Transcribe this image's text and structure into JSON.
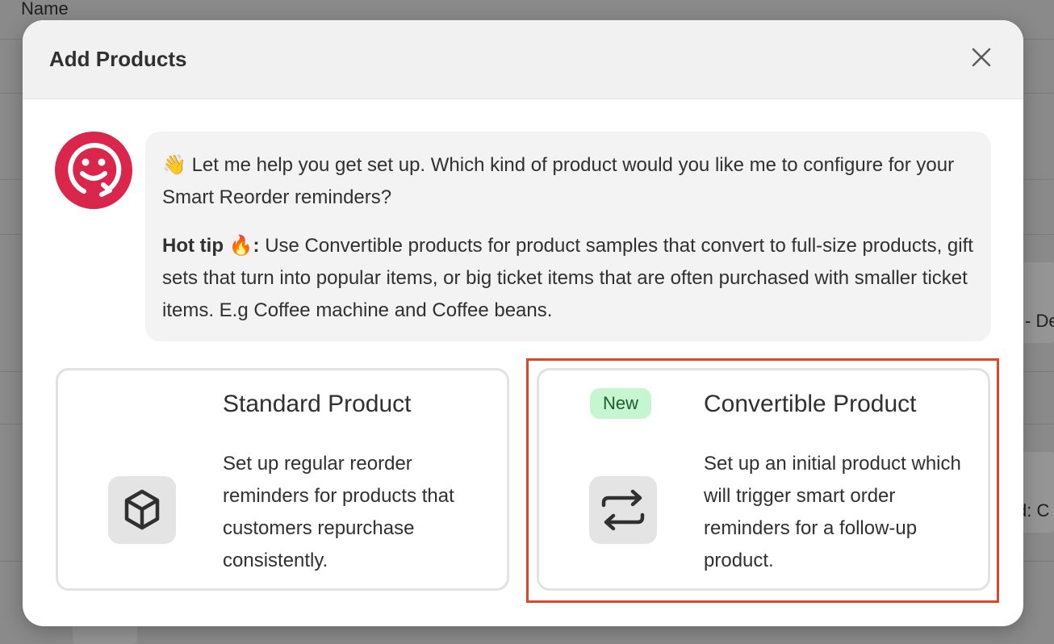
{
  "background": {
    "column_header": "Name",
    "partial_texts": [
      "- De",
      "d: C"
    ]
  },
  "modal": {
    "title": "Add Products",
    "close_icon": "close-icon",
    "assistant": {
      "avatar_icon": "smiley-reorder-icon",
      "avatar_color": "#d9264a",
      "intro_emoji": "👋",
      "intro_text": "Let me help you get set up. Which kind of product would you like me to configure for your Smart Reorder reminders?",
      "hot_tip_label": "Hot tip 🔥:",
      "hot_tip_text": "Use Convertible products for product samples that convert to full-size products, gift sets that turn into popular items, or big ticket items that are often purchased with smaller ticket items. E.g Coffee machine and Coffee beans."
    },
    "options": [
      {
        "id": "standard",
        "title": "Standard Product",
        "description": "Set up regular reorder reminders for products that customers repurchase consistently.",
        "icon": "cube-icon",
        "badge": null
      },
      {
        "id": "convertible",
        "title": "Convertible Product",
        "description": "Set up an initial product which will trigger smart order reminders for a follow-up product.",
        "icon": "repeat-arrows-icon",
        "badge": "New",
        "highlighted": true
      }
    ],
    "colors": {
      "highlight": "#e0462a",
      "badge_bg": "#c6f6cf",
      "badge_text": "#1a5e2a"
    }
  }
}
